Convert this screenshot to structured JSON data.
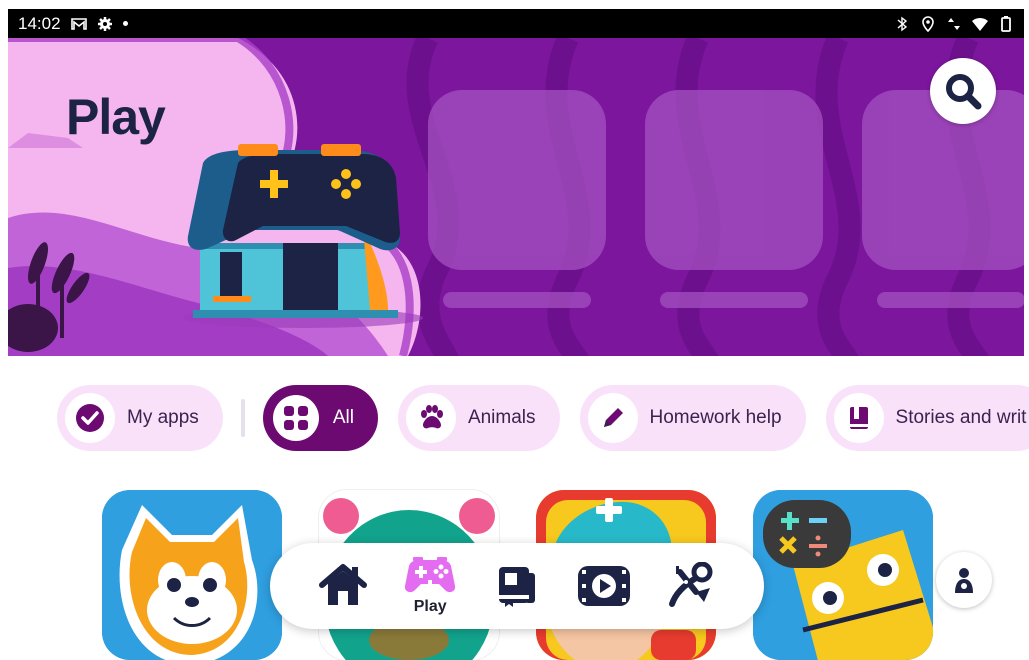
{
  "status_bar": {
    "time": "14:02",
    "left_icons": [
      "gmail-icon",
      "settings-icon",
      "dot-icon"
    ],
    "right_icons": [
      "bluetooth-icon",
      "location-icon",
      "data-arrows-icon",
      "wifi-icon",
      "battery-icon"
    ]
  },
  "hero": {
    "title": "Play",
    "search_icon": "search-icon"
  },
  "chips": [
    {
      "label": "My apps",
      "icon": "check-circle-icon",
      "active": false
    },
    {
      "label": "All",
      "icon": "grid-icon",
      "active": true
    },
    {
      "label": "Animals",
      "icon": "paw-icon",
      "active": false
    },
    {
      "label": "Homework help",
      "icon": "pencil-icon",
      "active": false
    },
    {
      "label": "Stories and writ",
      "icon": "book-icon",
      "active": false
    }
  ],
  "bottom_nav": {
    "items": [
      {
        "name": "home",
        "icon": "home-icon"
      },
      {
        "name": "play",
        "icon": "gamepad-icon",
        "label": "Play",
        "active": true
      },
      {
        "name": "books",
        "icon": "books-icon"
      },
      {
        "name": "video",
        "icon": "video-icon"
      },
      {
        "name": "create",
        "icon": "scissors-icon"
      }
    ]
  },
  "parent_button_icon": "parent-profile-icon",
  "colors": {
    "hero_purple": "#7b169d",
    "hero_pink": "#f5b6f0",
    "chip_bg": "#f9e1fa",
    "chip_active": "#6d0a72",
    "title_navy": "#1d2345"
  }
}
